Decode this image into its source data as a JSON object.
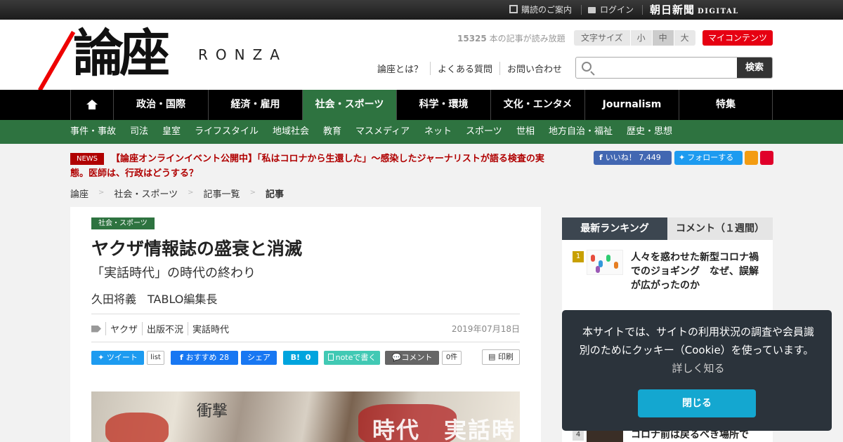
{
  "topbar": {
    "guide": "購読のご案内",
    "login": "ログイン",
    "brand": "朝日新聞",
    "brand_sub": "DIGITAL"
  },
  "header": {
    "logo": "論座",
    "logo_en": "RONZA",
    "articles_count": "15325",
    "articles_text": "本の記事が読み放題",
    "fontsize_label": "文字サイズ",
    "fontsize_options": [
      "小",
      "中",
      "大"
    ],
    "fontsize_selected": "中",
    "my_contents": "マイコンテンツ",
    "links": [
      "論座とは？",
      "よくある質問",
      "お問い合わせ"
    ],
    "search_placeholder": "",
    "search_button": "検索"
  },
  "nav": {
    "tabs": [
      "政治・国際",
      "経済・雇用",
      "社会・スポーツ",
      "科学・環境",
      "文化・エンタメ",
      "Journalism",
      "特集"
    ],
    "active": "社会・スポーツ",
    "home_icon": "home-icon"
  },
  "subnav": [
    "事件・事故",
    "司法",
    "皇室",
    "ライフスタイル",
    "地域社会",
    "教育",
    "マスメディア",
    "ネット",
    "スポーツ",
    "世相",
    "地方自治・福祉",
    "歴史・思想"
  ],
  "news": {
    "badge": "NEWS",
    "text": "【論座オンラインイベント公開中】「私はコロナから生還した」～感染したジャーナリストが語る検査の実態。医師は、行政はどうする？"
  },
  "social": {
    "fb_like": "いいね！",
    "fb_count": "7,449",
    "twitter_follow": "フォローする"
  },
  "breadcrumb": [
    "論座",
    "社会・スポーツ",
    "記事一覧",
    "記事"
  ],
  "article": {
    "category": "社会・スポーツ",
    "title": "ヤクザ情報誌の盛衰と消滅",
    "subtitle": "「実話時代」の時代の終わり",
    "author": "久田将義　TABLO編集長",
    "tags": [
      "ヤクザ",
      "出版不況",
      "実話時代"
    ],
    "date": "2019年07月18日",
    "share": {
      "tweet": "ツイート",
      "list": "list",
      "fb_recommend": "おすすめ",
      "fb_count": "28",
      "fb_share": "シェア",
      "hatena": "B!",
      "hatena_count": "0",
      "note": "noteで書く",
      "comment": "コメント",
      "comment_count": "0件",
      "print": "印刷"
    },
    "photo_text": "時代　実話時",
    "photo_text2": "衝撃"
  },
  "ranking": {
    "tab_latest": "最新ランキング",
    "tab_comments": "コメント（１週間）",
    "items": [
      {
        "rank": "1",
        "title": "人々を惑わせた新型コロナ禍でのジョギング　なぜ、誤解が広がったのか"
      },
      {
        "rank": "4",
        "title": "コロナ前は戻るべき場所で"
      }
    ]
  },
  "cookie": {
    "message": "本サイトでは、サイトの利用状況の調査や会員識別のためにクッキー（Cookie）を使っています。",
    "more": "詳しく知る",
    "close": "閉じる"
  }
}
